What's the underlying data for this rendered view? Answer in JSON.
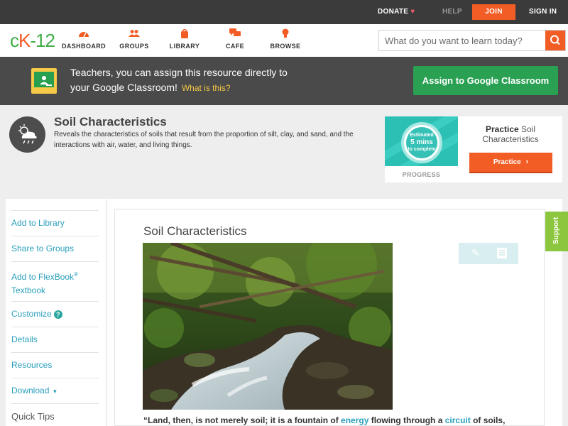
{
  "topbar": {
    "donate": "DONATE",
    "help": "HELP",
    "join": "JOIN",
    "sign_in": "SIGN IN"
  },
  "nav": {
    "logo_c": "c",
    "logo_k": "K",
    "logo_n": "-12",
    "items": [
      {
        "label": "DASHBOARD",
        "icon": "dashboard-gauge-icon"
      },
      {
        "label": "GROUPS",
        "icon": "groups-people-icon"
      },
      {
        "label": "LIBRARY",
        "icon": "library-bag-icon"
      },
      {
        "label": "CAFE",
        "icon": "cafe-chat-icon"
      },
      {
        "label": "BROWSE",
        "icon": "browse-lightbulb-icon"
      }
    ],
    "search_placeholder": "What do you want to learn today?"
  },
  "classroom_banner": {
    "line1": "Teachers, you can assign this resource directly to",
    "line2": "your Google Classroom!",
    "what_link": "What is this?",
    "assign_button": "Assign to Google Classroom"
  },
  "concept": {
    "title": "Soil Characteristics",
    "description": "Reveals the characteristics of soils that result from the proportion of silt, clay, and sand, and the interactions with air, water, and living things.",
    "icon": "weather-cloud-icon",
    "estimate_line1": "Estimated",
    "estimate_line2": "5 mins",
    "estimate_line3": "to complete",
    "progress_label": "PROGRESS",
    "practice_bold": "Practice",
    "practice_rest": " Soil Characteristics",
    "practice_button": "Practice"
  },
  "sidebar": {
    "items": [
      {
        "label": "Add to Library"
      },
      {
        "label": "Share to Groups"
      },
      {
        "label": "Add to FlexBook",
        "sup": "®",
        "line2": "Textbook"
      },
      {
        "label": "Customize"
      },
      {
        "label": "Details"
      },
      {
        "label": "Resources"
      },
      {
        "label": "Download"
      },
      {
        "label": "Quick Tips"
      }
    ]
  },
  "article": {
    "title": "Soil Characteristics",
    "quote_part1": "“Land, then, is not merely soil; it is a fountain of ",
    "quote_link1": "energy",
    "quote_part2": " flowing through a ",
    "quote_link2": "circuit",
    "quote_part3": " of soils,"
  },
  "support_tab": "Support",
  "colors": {
    "accent": "#f25c25",
    "brand_green": "#3fae49",
    "link": "#2a9fbd",
    "classroom_green": "#2aa052",
    "teal": "#2cbfb4"
  }
}
